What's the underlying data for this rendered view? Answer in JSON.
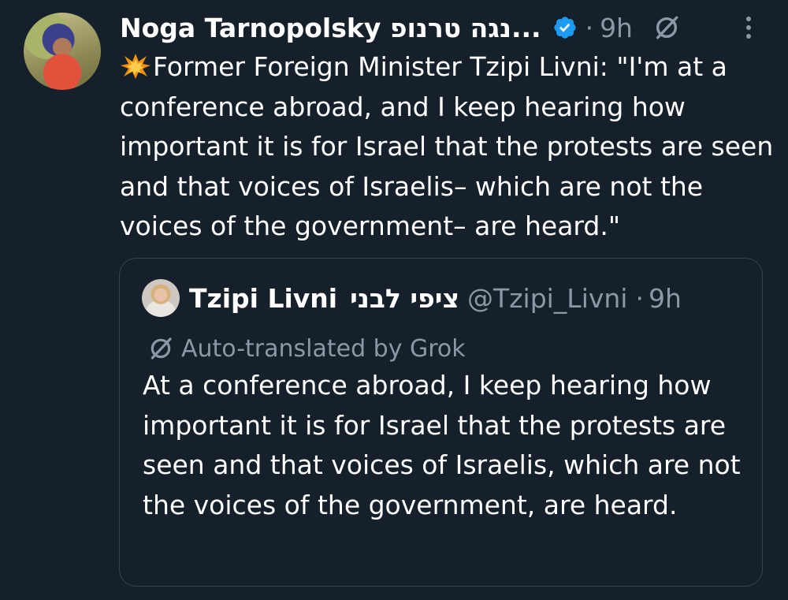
{
  "tweet": {
    "author_name": "Noga Tarnopolsky נגה טרנופ...",
    "time": "9h",
    "separator": "·",
    "emoji": "💥",
    "text": "Former Foreign Minister Tzipi Livni: \"I'm at a conference abroad, and I keep hearing how important it is for Israel that the protests are seen and that voices of Israelis– which are not the voices of the government– are heard.\"",
    "icons": [
      "verified-badge-icon",
      "grok-icon",
      "more-options-icon"
    ],
    "accent_color": "#1d9bf0",
    "background_color": "#15202b"
  },
  "quote": {
    "author_name": "Tzipi Livni",
    "author_name_hebrew": "ציפי לבני",
    "handle": "@Tzipi_Livni",
    "separator": "·",
    "time": "9h",
    "translation_label": "Auto-translated by Grok",
    "text": "At a conference abroad, I keep hearing how important it is for Israel that the protests are seen and that voices of Israelis, which are not the voices of the government, are heard."
  }
}
